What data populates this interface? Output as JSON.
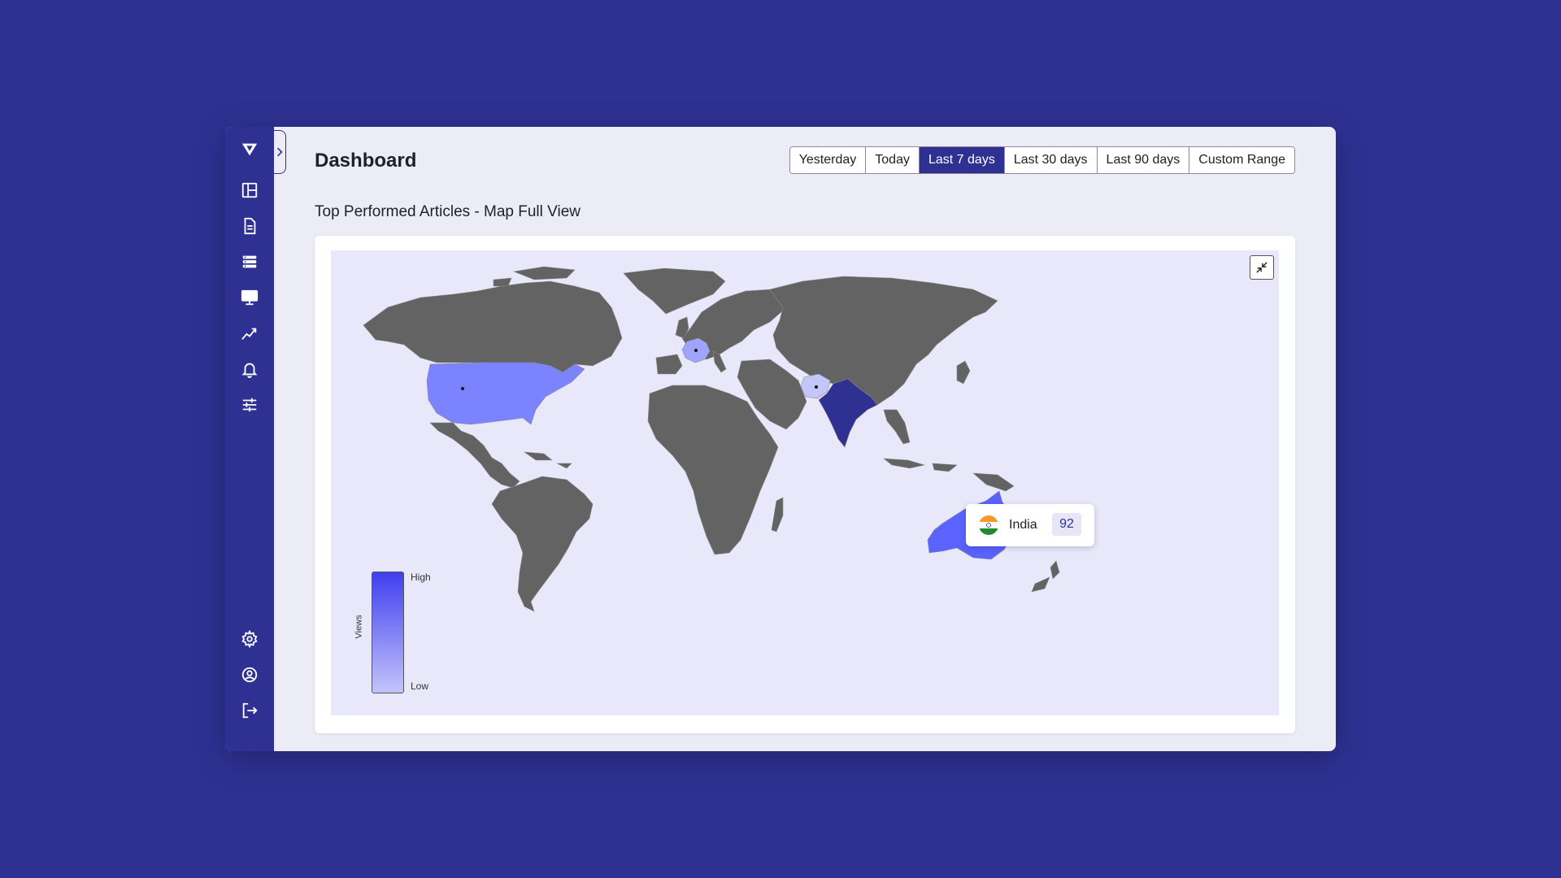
{
  "header": {
    "title": "Dashboard",
    "date_ranges": [
      "Yesterday",
      "Today",
      "Last 7 days",
      "Last 30 days",
      "Last 90 days",
      "Custom Range"
    ],
    "active_range": "Last 7 days"
  },
  "section": {
    "title": "Top Performed Articles - Map Full View"
  },
  "legend": {
    "title": "Views",
    "high_label": "High",
    "low_label": "Low",
    "high_color": "#3f3ff0",
    "low_color": "#c4c4fb"
  },
  "tooltip": {
    "country": "India",
    "value": "92"
  },
  "highlighted_countries": [
    {
      "name": "India",
      "color": "#2e3192"
    },
    {
      "name": "Australia",
      "color": "#5a62ff"
    },
    {
      "name": "United States",
      "color": "#7b83ff"
    },
    {
      "name": "France",
      "color": "#9ea4ff"
    },
    {
      "name": "Afghanistan",
      "color": "#c2c6fb"
    }
  ],
  "sidebar": {
    "icons": [
      "logo-icon",
      "dashboard-icon",
      "document-icon",
      "list-icon",
      "monitor-icon",
      "analytics-icon",
      "bell-icon",
      "sliders-icon",
      "gear-icon",
      "user-icon",
      "logout-icon"
    ]
  },
  "colors": {
    "brand": "#2e3192",
    "land": "#636363",
    "map_background": "#e9e8fb"
  }
}
